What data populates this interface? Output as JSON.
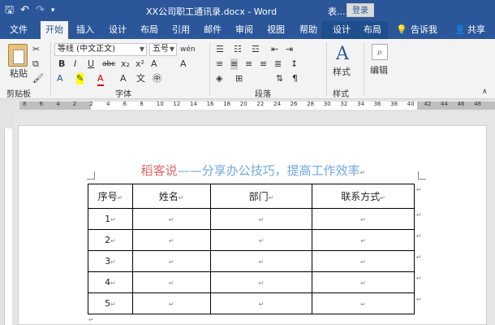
{
  "titlebar": {
    "doc_title": "XX公司职工通讯录.docx - Word",
    "right_text": "表...",
    "login": "登录"
  },
  "tabs": [
    {
      "label": "文件",
      "active": false
    },
    {
      "label": "开始",
      "active": true
    },
    {
      "label": "插入",
      "active": false
    },
    {
      "label": "设计",
      "active": false
    },
    {
      "label": "布局",
      "active": false
    },
    {
      "label": "引用",
      "active": false
    },
    {
      "label": "邮件",
      "active": false
    },
    {
      "label": "审阅",
      "active": false
    },
    {
      "label": "视图",
      "active": false
    },
    {
      "label": "帮助",
      "active": false
    },
    {
      "label": "设计",
      "active": false
    },
    {
      "label": "布局",
      "active": false
    }
  ],
  "tell_me": "告诉我",
  "share": "共享",
  "ribbon": {
    "paste_label": "粘贴",
    "clipboard_label": "剪贴板",
    "font_name": "等线 (中文正文)",
    "font_size": "五号",
    "font_label": "字体",
    "paragraph_label": "段落",
    "styles_label": "样式",
    "styles_button": "样式",
    "editing_button": "编辑",
    "font_buttons": [
      "B",
      "I",
      "U",
      "abc",
      "x₂",
      "x²",
      "A"
    ]
  },
  "ruler_numbers": [
    "8",
    "6",
    "4",
    "2",
    "2",
    "4",
    "6",
    "8",
    "10",
    "12",
    "14",
    "16",
    "18",
    "20",
    "22",
    "24",
    "26",
    "28",
    "30",
    "32",
    "34",
    "36",
    "38",
    "40",
    "42",
    "44",
    "46",
    "48"
  ],
  "document": {
    "heading_red": "稻客说",
    "heading_blue": "——分享办公技巧，提高工作效率",
    "headers": [
      "序号",
      "姓名",
      "部门",
      "联系方式"
    ],
    "rows": [
      [
        "1",
        "",
        "",
        ""
      ],
      [
        "2",
        "",
        "",
        ""
      ],
      [
        "3",
        "",
        "",
        ""
      ],
      [
        "4",
        "",
        "",
        ""
      ],
      [
        "5",
        "",
        "",
        ""
      ]
    ],
    "para_mark": "↵"
  },
  "colors": {
    "brand": "#2b579a",
    "heading_red": "#e06666",
    "heading_blue": "#6fa8dc"
  }
}
